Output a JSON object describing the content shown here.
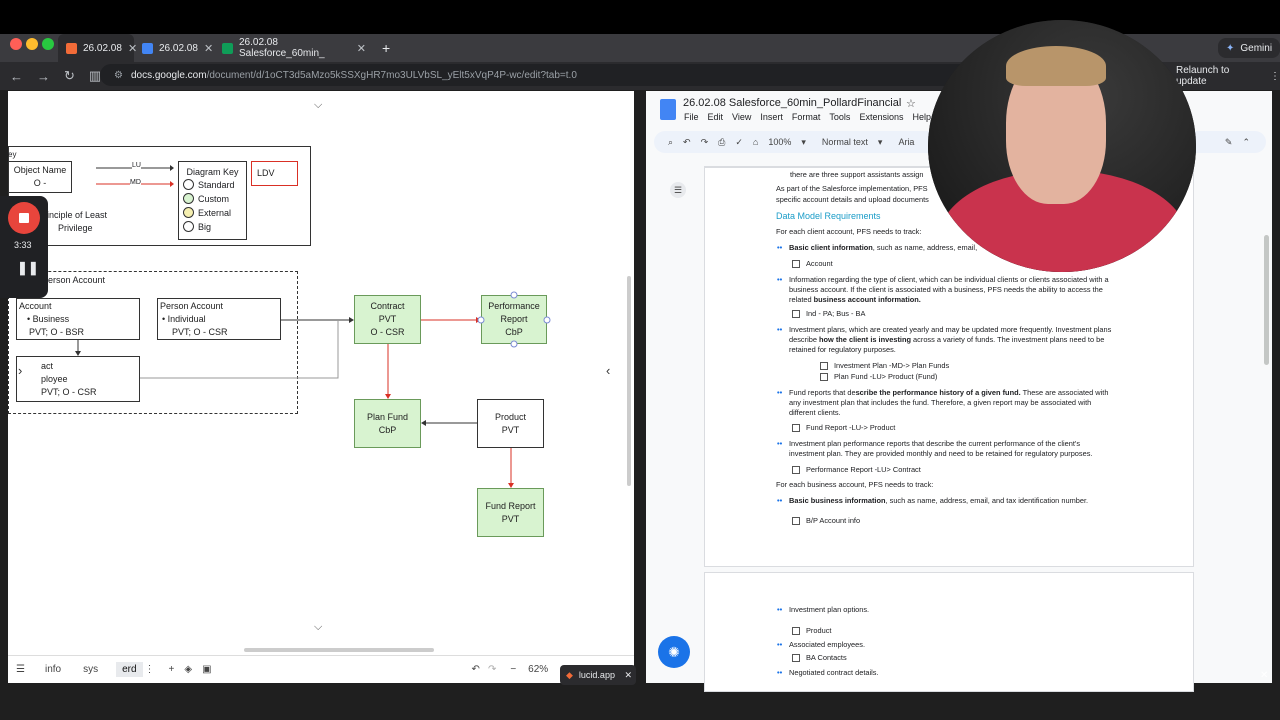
{
  "browser": {
    "tabs": [
      {
        "label": "26.02.08"
      },
      {
        "label": "26.02.08"
      },
      {
        "label": "26.02.08 Salesforce_60min_"
      }
    ],
    "new_tab": "+",
    "gemini": "Gemini",
    "url_domain": "docs.google.com",
    "url_path": "/document/d/1oCT3d5aMzo5kSSXgHR7mo3ULVbSL_yElt5xVqP4P-wc/edit?tab=t.0",
    "relaunch": "Relaunch to update"
  },
  "recorder": {
    "time": "3:33"
  },
  "lucid": {
    "key_box": {
      "title": "ey",
      "object_name": "Object Name",
      "object_sub": "O -",
      "lu": "LU",
      "md": "MD",
      "least": "rinciple of Least",
      "privilege": "Privilege"
    },
    "diagram_key": {
      "title": "Diagram Key",
      "items": [
        "Standard",
        "Custom",
        "External",
        "Big"
      ],
      "ldv": "LDV"
    },
    "person_account_label": "Person Account",
    "nodes": {
      "account": {
        "title": "Account",
        "l1": "• Business",
        "l2": "PVT; O - BSR"
      },
      "person_account": {
        "title": "Person Account",
        "l1": "• Individual",
        "l2": "PVT; O - CSR"
      },
      "contact": {
        "title": "act",
        "l1": "ployee",
        "l2": "PVT; O - CSR"
      },
      "contract": {
        "l1": "Contract",
        "l2": "PVT",
        "l3": "O - CSR"
      },
      "performance": {
        "l1": "Performance",
        "l2": "Report",
        "l3": "CbP"
      },
      "planfund": {
        "l1": "Plan Fund",
        "l2": "CbP"
      },
      "product": {
        "l1": "Product",
        "l2": "PVT"
      },
      "fundreport": {
        "l1": "Fund Report",
        "l2": "PVT"
      }
    },
    "bottom": {
      "tab1": "info",
      "tab2": "sys",
      "tab3": "erd",
      "zoom": "62%",
      "app": "lucid.app"
    }
  },
  "docs": {
    "title": "26.02.08 Salesforce_60min_PollardFinancial",
    "menu": [
      "File",
      "Edit",
      "View",
      "Insert",
      "Format",
      "Tools",
      "Extensions",
      "Help"
    ],
    "zoom": "100%",
    "style": "Normal text",
    "font": "Aria",
    "body": {
      "line0": "there are three support assistants assign",
      "para1a": "As part of the Salesforce implementation, PFS",
      "para1b": "specific account details and upload documents",
      "heading": "Data Model Requirements",
      "intro": "For each client account, PFS needs to track:",
      "b1_bold": "Basic client information",
      "b1_rest": ", such as name, address, email,",
      "c1": "Account",
      "b2a": "Information regarding the type of client, which can be individual clients or clients associated  with a",
      "b2b": "business account. If the client is associated with a business, PFS needs the ability to  access the",
      "b2c_pre": "related ",
      "b2c_bold": "business account information.",
      "c2": "Ind - PA; Bus - BA",
      "b3a": "Investment plans, which are created yearly and may be updated more frequently. Investment  plans",
      "b3b_pre": "describe ",
      "b3b_bold": "how the client is investing",
      "b3b_post": " across a variety of funds. The investment plans need  to be",
      "b3c": "retained for regulatory purposes.",
      "c3a": "Investment Plan -MD-> Plan Funds",
      "c3b": "Plan Fund -LU> Product (Fund)",
      "b4a_pre": "Fund reports that de",
      "b4a_bold": "scribe the performance history of a given fund.",
      "b4a_post": " These are associated with",
      "b4b": "any investment plan that includes the fund. Therefore, a given report may be associated with",
      "b4c": "different clients.",
      "c4": "Fund Report -LU-> Product",
      "b5a": "Investment plan performance reports that describe the current performance of the client's",
      "b5b": "investment plan. They are provided monthly and need to be retained for regulatory purposes.",
      "c5": "Performance Report -LU> Contract",
      "intro2": "For each business account, PFS needs to track:",
      "b6_bold": "Basic business information",
      "b6_rest": ", such as name, address, email, and tax identification number.",
      "c6": "B/P Account info",
      "p2_b1": "Investment plan options.",
      "p2_c1": "Product",
      "p2_b2": "Associated employees.",
      "p2_c2": "BA Contacts",
      "p2_b3": "Negotiated contract details."
    }
  },
  "colors": {
    "accent": "#1a73e8",
    "green_node": "#d8f3d0",
    "red_arrow": "#d93025"
  }
}
